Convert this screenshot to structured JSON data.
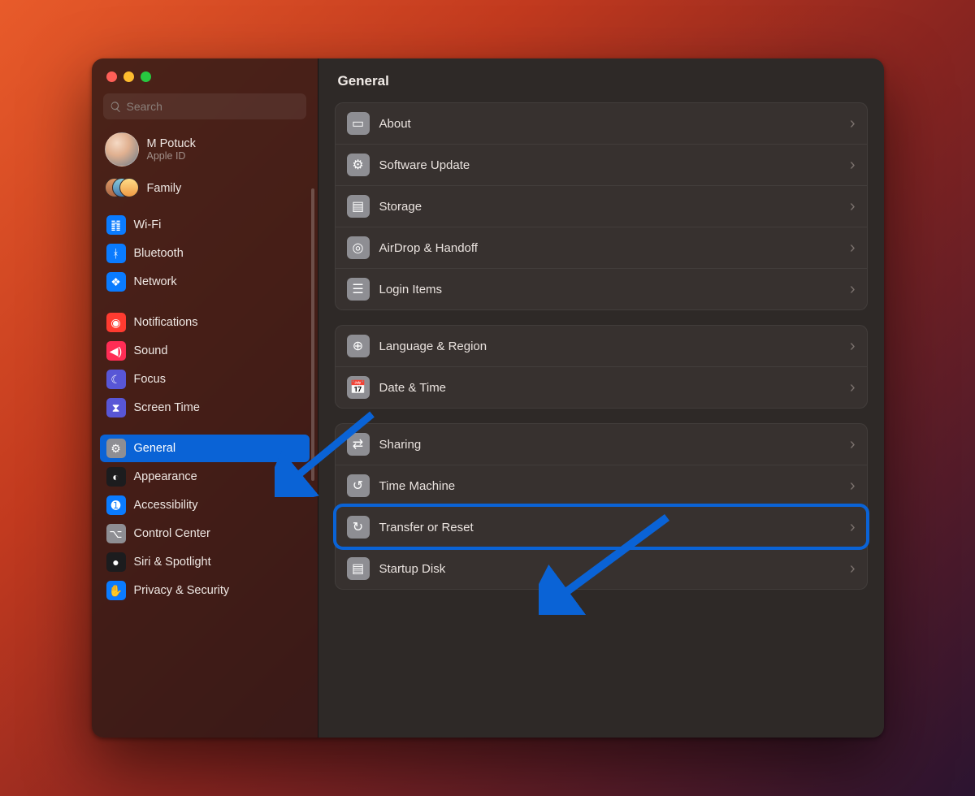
{
  "window": {
    "title": "General"
  },
  "search": {
    "placeholder": "Search"
  },
  "account": {
    "name": "M Potuck",
    "subtitle": "Apple ID"
  },
  "family": {
    "label": "Family"
  },
  "sidebar": {
    "items": [
      {
        "label": "Wi-Fi",
        "icon": "wifi-icon",
        "color": "ic-blue"
      },
      {
        "label": "Bluetooth",
        "icon": "bluetooth-icon",
        "color": "ic-blue"
      },
      {
        "label": "Network",
        "icon": "network-icon",
        "color": "ic-blue"
      },
      {
        "label": "Notifications",
        "icon": "notifications-icon",
        "color": "ic-red"
      },
      {
        "label": "Sound",
        "icon": "sound-icon",
        "color": "ic-pink"
      },
      {
        "label": "Focus",
        "icon": "focus-icon",
        "color": "ic-indigo"
      },
      {
        "label": "Screen Time",
        "icon": "screentime-icon",
        "color": "ic-indigo"
      },
      {
        "label": "General",
        "icon": "general-icon",
        "color": "ic-gray",
        "selected": true
      },
      {
        "label": "Appearance",
        "icon": "appearance-icon",
        "color": "ic-black"
      },
      {
        "label": "Accessibility",
        "icon": "accessibility-icon",
        "color": "ic-blue"
      },
      {
        "label": "Control Center",
        "icon": "controlcenter-icon",
        "color": "ic-gray"
      },
      {
        "label": "Siri & Spotlight",
        "icon": "siri-icon",
        "color": "ic-black"
      },
      {
        "label": "Privacy & Security",
        "icon": "privacy-icon",
        "color": "ic-blue"
      }
    ]
  },
  "content": {
    "groups": [
      [
        {
          "label": "About",
          "icon": "about-icon",
          "color": ""
        },
        {
          "label": "Software Update",
          "icon": "softwareupdate-icon",
          "color": ""
        },
        {
          "label": "Storage",
          "icon": "storage-icon",
          "color": ""
        },
        {
          "label": "AirDrop & Handoff",
          "icon": "airdrop-icon",
          "color": ""
        },
        {
          "label": "Login Items",
          "icon": "loginitems-icon",
          "color": ""
        }
      ],
      [
        {
          "label": "Language & Region",
          "icon": "language-icon",
          "color": "ric-blue"
        },
        {
          "label": "Date & Time",
          "icon": "datetime-icon",
          "color": "ric-blue"
        }
      ],
      [
        {
          "label": "Sharing",
          "icon": "sharing-icon",
          "color": ""
        },
        {
          "label": "Time Machine",
          "icon": "timemachine-icon",
          "color": "ric-dark"
        },
        {
          "label": "Transfer or Reset",
          "icon": "transferreset-icon",
          "color": "",
          "highlight": true
        },
        {
          "label": "Startup Disk",
          "icon": "startupdisk-icon",
          "color": ""
        }
      ]
    ]
  },
  "icons": {
    "wifi-icon": "䷇",
    "bluetooth-icon": "ᚼ",
    "network-icon": "❖",
    "notifications-icon": "◉",
    "sound-icon": "◀)",
    "focus-icon": "☾",
    "screentime-icon": "⧗",
    "general-icon": "⚙",
    "appearance-icon": "◐",
    "accessibility-icon": "➊",
    "controlcenter-icon": "⌥",
    "siri-icon": "●",
    "privacy-icon": "✋",
    "about-icon": "▭",
    "softwareupdate-icon": "⚙",
    "storage-icon": "▤",
    "airdrop-icon": "◎",
    "loginitems-icon": "☰",
    "language-icon": "⊕",
    "datetime-icon": "📅",
    "sharing-icon": "⇄",
    "timemachine-icon": "↺",
    "transferreset-icon": "↻",
    "startupdisk-icon": "▤"
  }
}
